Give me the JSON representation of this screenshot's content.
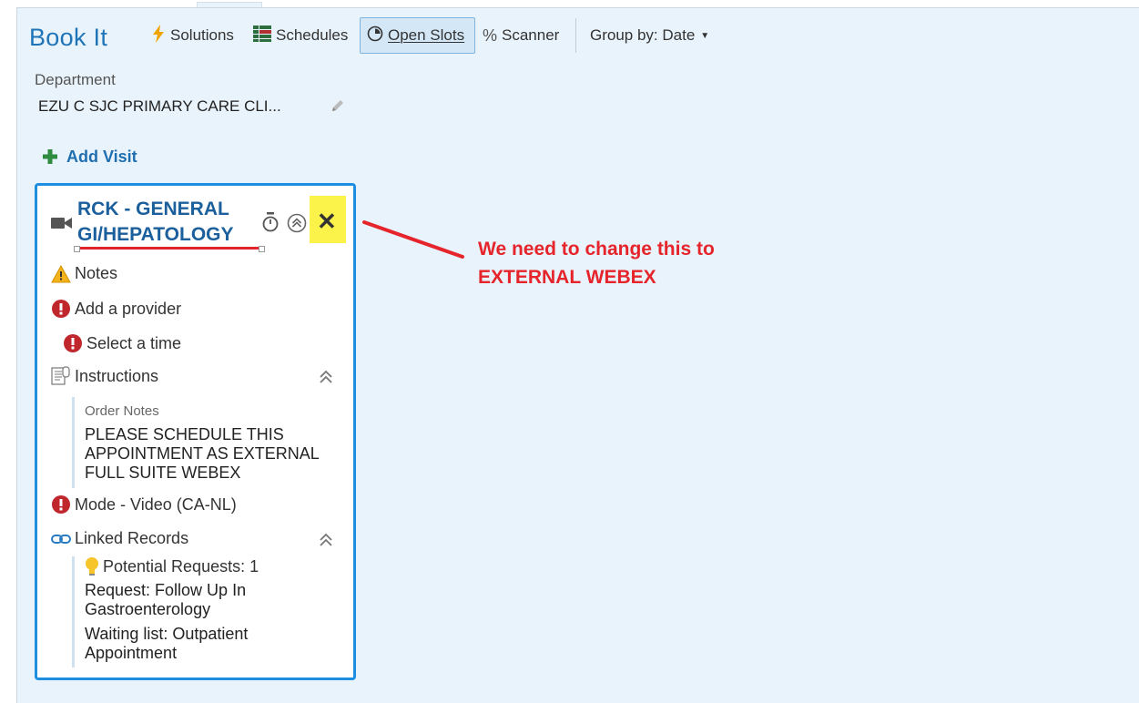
{
  "app": {
    "title": "Book It"
  },
  "toolbar": {
    "solutions": "Solutions",
    "schedules": "Schedules",
    "open_slots": "Open Slots",
    "scanner": "Scanner",
    "group_by": "Group by: Date"
  },
  "department": {
    "label": "Department",
    "value": "EZU C SJC PRIMARY CARE CLI..."
  },
  "add_visit": "Add Visit",
  "visit_card": {
    "title_line1": "RCK - GENERAL",
    "title_line2": "GI/HEPATOLOGY",
    "notes": "Notes",
    "add_provider": "Add a provider",
    "select_time": "Select a time",
    "instructions": "Instructions",
    "order_notes_label": "Order Notes",
    "order_notes_text": "PLEASE SCHEDULE THIS APPOINTMENT AS EXTERNAL FULL SUITE WEBEX",
    "mode": "Mode - Video (CA-NL)",
    "linked_records": "Linked Records",
    "potential_requests": "Potential Requests: 1",
    "request": "Request: Follow Up In Gastroenterology",
    "waiting_list": "Waiting list: Outpatient Appointment"
  },
  "annotation": {
    "line1": "We need to change this to",
    "line2": "EXTERNAL WEBEX"
  },
  "colors": {
    "accent_blue": "#1f74b8",
    "card_border": "#1e8ee0",
    "error_red": "#c0272d",
    "annotation_red": "#e5242b",
    "highlight_yellow": "#fbf34a"
  }
}
